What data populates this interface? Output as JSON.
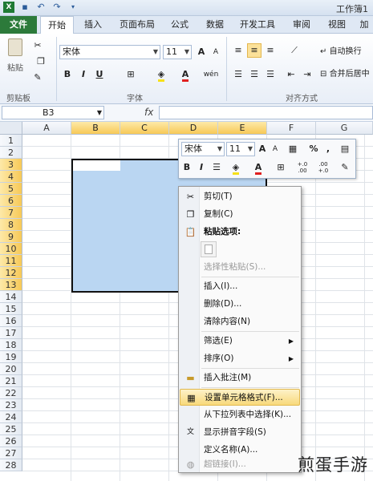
{
  "title": "工作簿1",
  "tabs": [
    "文件",
    "开始",
    "插入",
    "页面布局",
    "公式",
    "数据",
    "开发工具",
    "审阅",
    "视图",
    "加"
  ],
  "ribbon": {
    "paste_label": "粘贴",
    "font_name": "宋体",
    "font_size": "11",
    "wrap_text": "自动换行",
    "merge_center": "合并后居中",
    "group_clipboard": "剪贴板",
    "group_font": "字体",
    "group_align": "对齐方式",
    "bold": "B",
    "italic": "I",
    "underline": "U",
    "font_color_a": "A",
    "grow_font": "A",
    "shrink_font": "A",
    "wen": "wén"
  },
  "formula_bar": {
    "name_box": "B3",
    "fx": "fx"
  },
  "columns": [
    "A",
    "B",
    "C",
    "D",
    "E",
    "F",
    "G"
  ],
  "rows": [
    "1",
    "2",
    "3",
    "4",
    "5",
    "6",
    "7",
    "8",
    "9",
    "10",
    "11",
    "12",
    "13",
    "14",
    "15",
    "16",
    "17",
    "18",
    "19",
    "20",
    "21",
    "22",
    "23",
    "24",
    "25",
    "26",
    "27",
    "28"
  ],
  "mini_toolbar": {
    "font_name": "宋体",
    "font_size": "11",
    "percent": "%",
    "comma": ",",
    "bold": "B",
    "italic": "I",
    "font_color": "A",
    "grow": "A",
    "shrink": "A",
    "inc_decimal": "+.0 .00",
    "dec_decimal": ".00 +.0"
  },
  "context_menu": {
    "cut": "剪切(T)",
    "copy": "复制(C)",
    "paste_options": "粘贴选项:",
    "paste_special": "选择性粘贴(S)...",
    "insert": "插入(I)...",
    "delete": "删除(D)...",
    "clear_contents": "清除内容(N)",
    "filter": "筛选(E)",
    "sort": "排序(O)",
    "insert_comment": "插入批注(M)",
    "format_cells": "设置单元格格式(F)...",
    "pick_from_list": "从下拉列表中选择(K)...",
    "phonetic": "显示拼音字段(S)",
    "define_name": "定义名称(A)...",
    "hyperlink": "超链接(I)..."
  },
  "watermark": "煎蛋手游",
  "colors": {
    "accent": "#2c7a3a",
    "selection": "#bad6f2",
    "highlight": "#f8d97b"
  }
}
